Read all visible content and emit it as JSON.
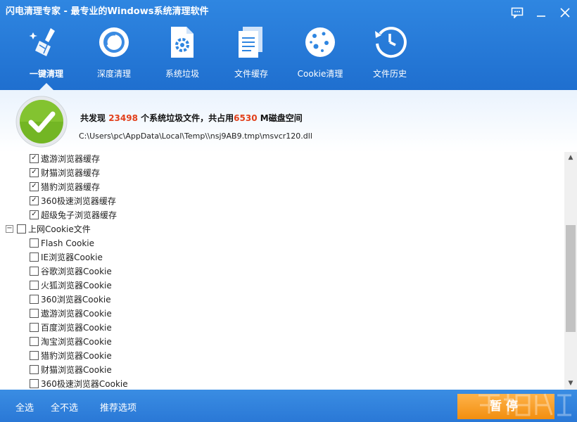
{
  "window": {
    "title": "闪电清理专家 - 最专业的Windows系统清理软件"
  },
  "tabs": [
    {
      "label": "一键清理",
      "icon": "broom-icon"
    },
    {
      "label": "深度清理",
      "icon": "disk-icon"
    },
    {
      "label": "系统垃圾",
      "icon": "gear-file-icon"
    },
    {
      "label": "文件缓存",
      "icon": "documents-icon"
    },
    {
      "label": "Cookie清理",
      "icon": "cookie-icon"
    },
    {
      "label": "文件历史",
      "icon": "history-clock-icon"
    }
  ],
  "status": {
    "prefix": "共发现",
    "file_count": "23498",
    "mid": "个系统垃圾文件，共占用",
    "size": "6530",
    "suffix": "M磁盘空间",
    "path": "C:\\Users\\pc\\AppData\\Local\\Temp\\\\nsj9AB9.tmp\\msvcr120.dll"
  },
  "tree": {
    "checked_items": [
      "遨游浏览器缓存",
      "财猫浏览器缓存",
      "猎豹浏览器缓存",
      "360极速浏览器缓存",
      "超级兔子浏览器缓存"
    ],
    "group": {
      "label": "上网Cookie文件",
      "checked": false,
      "expander": "−"
    },
    "group_items": [
      "Flash Cookie",
      "IE浏览器Cookie",
      "谷歌浏览器Cookie",
      "火狐浏览器Cookie",
      "360浏览器Cookie",
      "遨游浏览器Cookie",
      "百度浏览器Cookie",
      "淘宝浏览器Cookie",
      "猎豹浏览器Cookie",
      "财猫浏览器Cookie",
      "360极速浏览器Cookie"
    ]
  },
  "footer": {
    "select_all": "全选",
    "select_none": "全不选",
    "recommended": "推荐选项",
    "pause": "暂停"
  },
  "colors": {
    "header": "#2a7ad8",
    "highlight": "#e2401b",
    "pause": "#f59a1f",
    "ok": "#6fb31f"
  }
}
